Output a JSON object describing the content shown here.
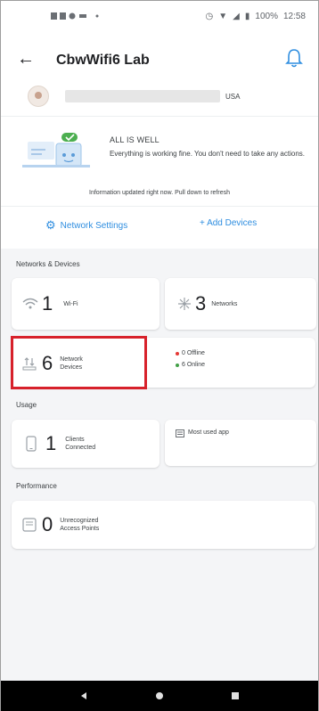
{
  "statusbar": {
    "left_icons": [
      "notification-icons"
    ],
    "battery": "100%",
    "time": "12:58"
  },
  "header": {
    "title": "CbwWifi6 Lab"
  },
  "account": {
    "country": "USA"
  },
  "status": {
    "title": "ALL IS WELL",
    "description": "Everything is working fine. You don't need to take any actions.",
    "badge": "ok",
    "updated": "Information updated right now. Pull down to refresh"
  },
  "actions": {
    "network_settings": "Network Settings",
    "add_devices": "+ Add Devices"
  },
  "sections": {
    "networks_devices": "Networks & Devices",
    "usage": "Usage",
    "performance": "Performance"
  },
  "cards": {
    "wifi": {
      "count": "1",
      "label": "Wi-Fi"
    },
    "networks": {
      "count": "3",
      "label": "Networks"
    },
    "network_devices": {
      "count": "6",
      "label_line1": "Network",
      "label_line2": "Devices"
    },
    "device_status": {
      "offline": "0 Offline",
      "online": "6 Online"
    },
    "clients": {
      "count": "1",
      "label_line1": "Clients",
      "label_line2": "Connected"
    },
    "most_used_app": {
      "label": "Most used app"
    },
    "unrecognized": {
      "count": "0",
      "label_line1": "Unrecognized",
      "label_line2": "Access Points"
    }
  },
  "colors": {
    "accent": "#2f8ee0",
    "highlight": "#d7212b",
    "offline": "#e53935",
    "online": "#43a047"
  }
}
